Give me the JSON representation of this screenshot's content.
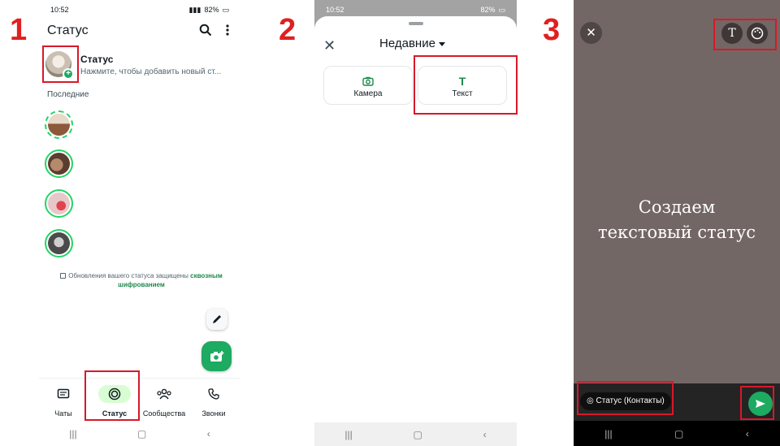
{
  "steps": [
    "1",
    "2",
    "3"
  ],
  "phone1": {
    "time": "10:52",
    "battery": "82%",
    "title": "Статус",
    "my_status": {
      "name": "Статус",
      "subtitle": "Нажмите, чтобы добавить новый ст..."
    },
    "recent_label": "Последние",
    "encryption_note": "Обновления вашего статуса защищены",
    "encryption_link": "сквозным шифрованием",
    "nav": [
      "Чаты",
      "Статус",
      "Сообщества",
      "Звонки"
    ],
    "accent": "#1daa61"
  },
  "phone2": {
    "time": "10:52",
    "battery": "82%",
    "sheet_title": "Недавние",
    "options": [
      {
        "icon": "camera-icon",
        "label": "Камера"
      },
      {
        "icon": "text-icon",
        "glyph": "T",
        "label": "Текст"
      }
    ]
  },
  "phone3": {
    "text_line1": "Создаем",
    "text_line2": "текстовый статус",
    "text_tool": "T",
    "audience": "Статус (Контакты)",
    "background": "#736765"
  },
  "highlight_color": "#d7192a"
}
